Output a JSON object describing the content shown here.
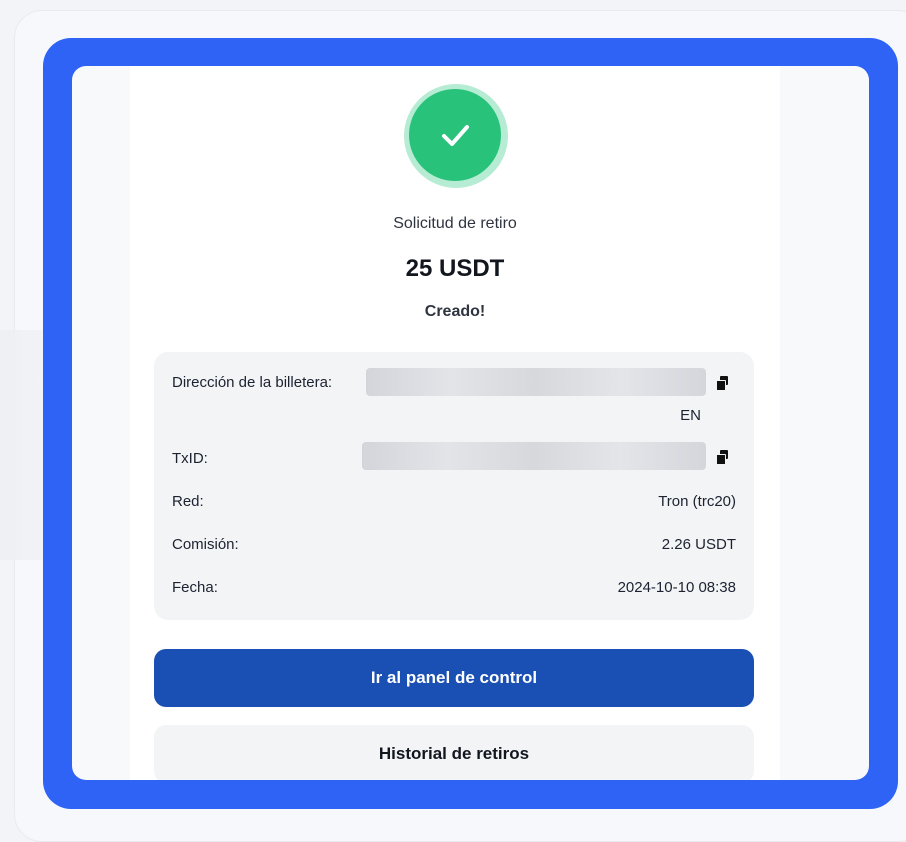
{
  "success": {
    "icon": "check-icon"
  },
  "request": {
    "title": "Solicitud de retiro",
    "amount": "25 USDT",
    "status": "Creado!"
  },
  "details": {
    "wallet_label": "Dirección de la billetera:",
    "wallet_network_tag": "EN",
    "txid_label": "TxID:",
    "network_label": "Red:",
    "network_value": "Tron (trc20)",
    "fee_label": "Comisión:",
    "fee_value": "2.26 USDT",
    "date_label": "Fecha:",
    "date_value": "2024-10-10 08:38"
  },
  "actions": {
    "dashboard": "Ir al panel de control",
    "history": "Historial de retiros"
  },
  "colors": {
    "frame": "#2f63f6",
    "success": "#28c27a",
    "primary_button": "#1a4fb4"
  }
}
